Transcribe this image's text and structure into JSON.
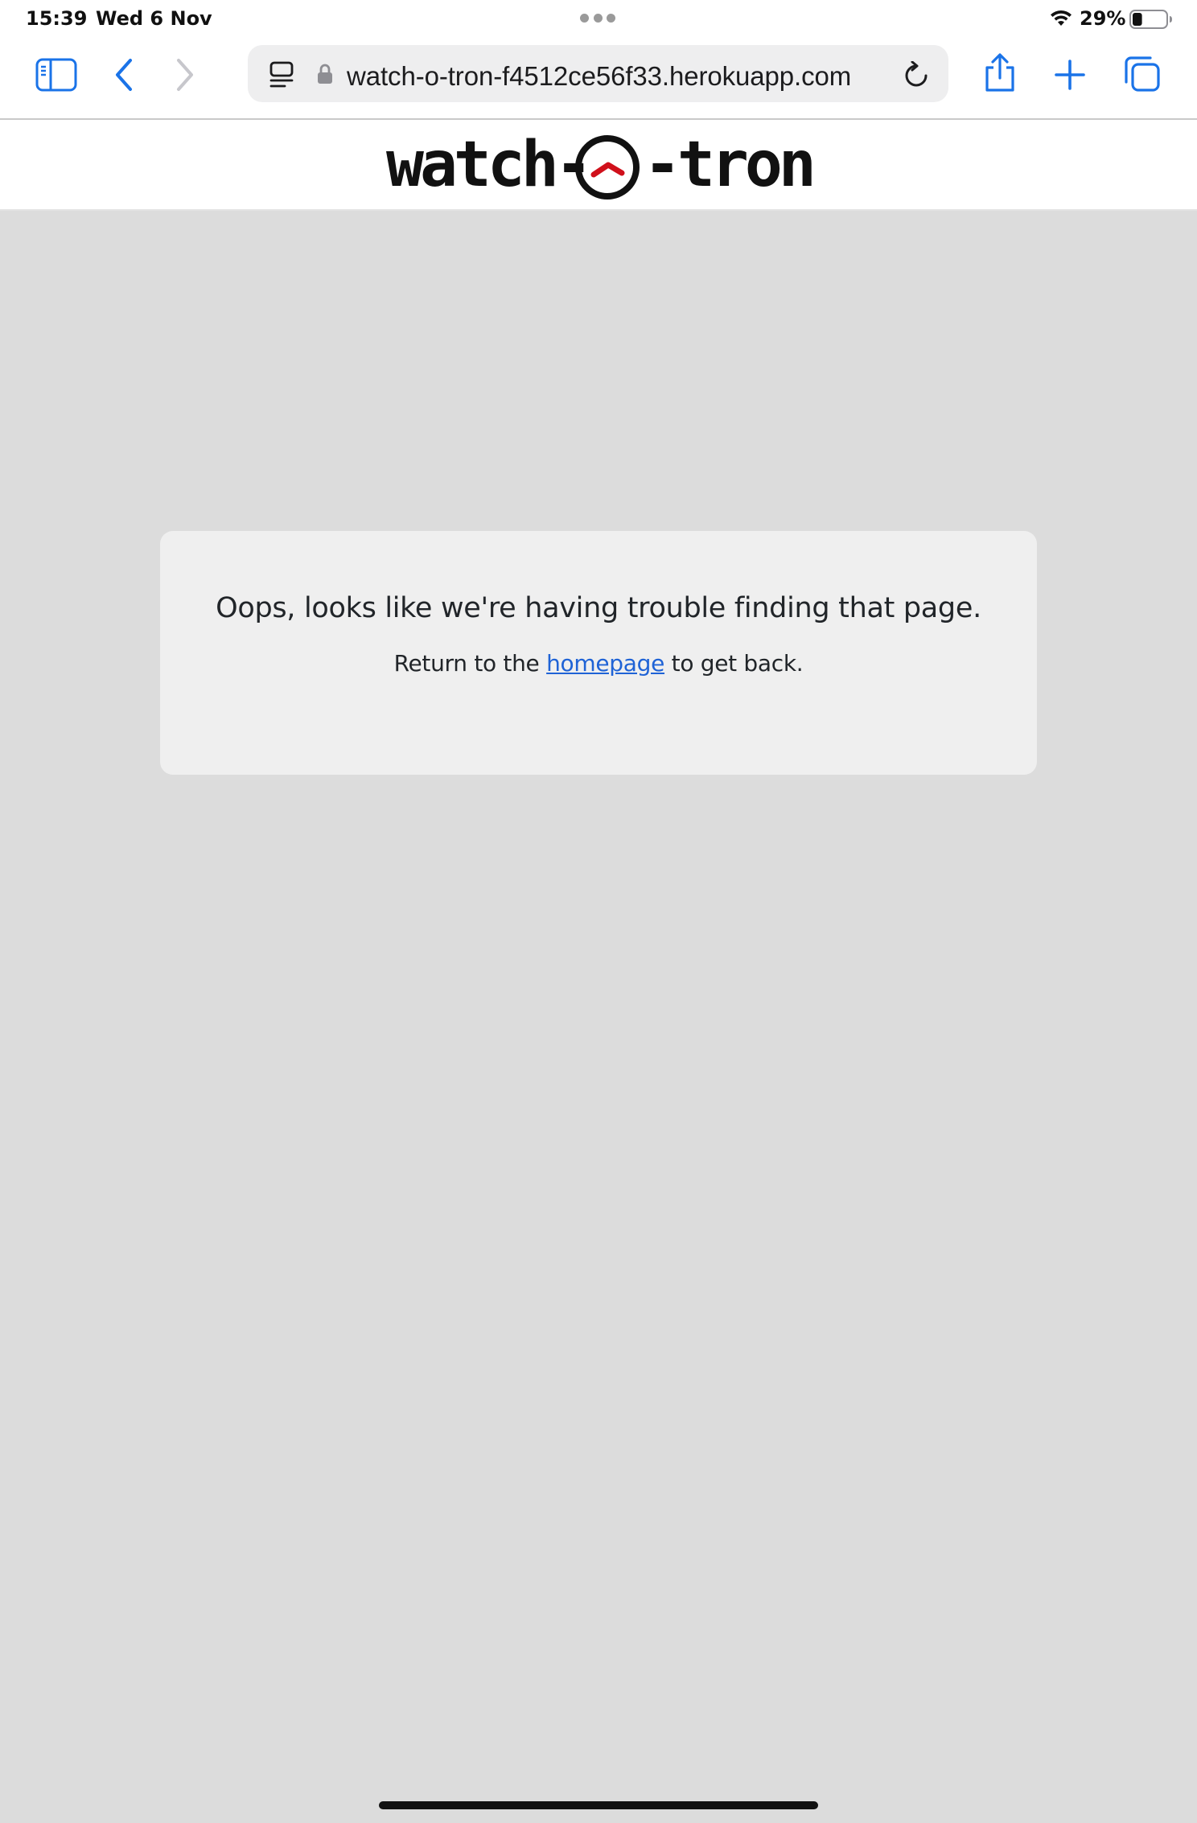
{
  "status_bar": {
    "time": "15:39",
    "date": "Wed 6 Nov",
    "battery_percent": "29%",
    "battery_level": 0.29,
    "icons": [
      "multitasking-dots",
      "wifi-icon",
      "battery-icon"
    ]
  },
  "browser": {
    "url": "watch-o-tron-f4512ce56f33.herokuapp.com",
    "accent_color": "#1a73e8",
    "icons": [
      "sidebar-icon",
      "back-icon",
      "forward-icon",
      "reader-icon",
      "lock-icon",
      "reload-icon",
      "share-icon",
      "new-tab-icon",
      "tabs-icon"
    ]
  },
  "site": {
    "logo": {
      "text_left": "watch-",
      "text_right": "-tron",
      "icon": "clock-logo-icon",
      "accent_color": "#d0101b"
    }
  },
  "error_card": {
    "heading": "Oops, looks like we're having trouble finding that page.",
    "text_before": "Return to the",
    "link_label": "homepage",
    "text_after": "to get back.",
    "link_color": "#1f63d6"
  }
}
